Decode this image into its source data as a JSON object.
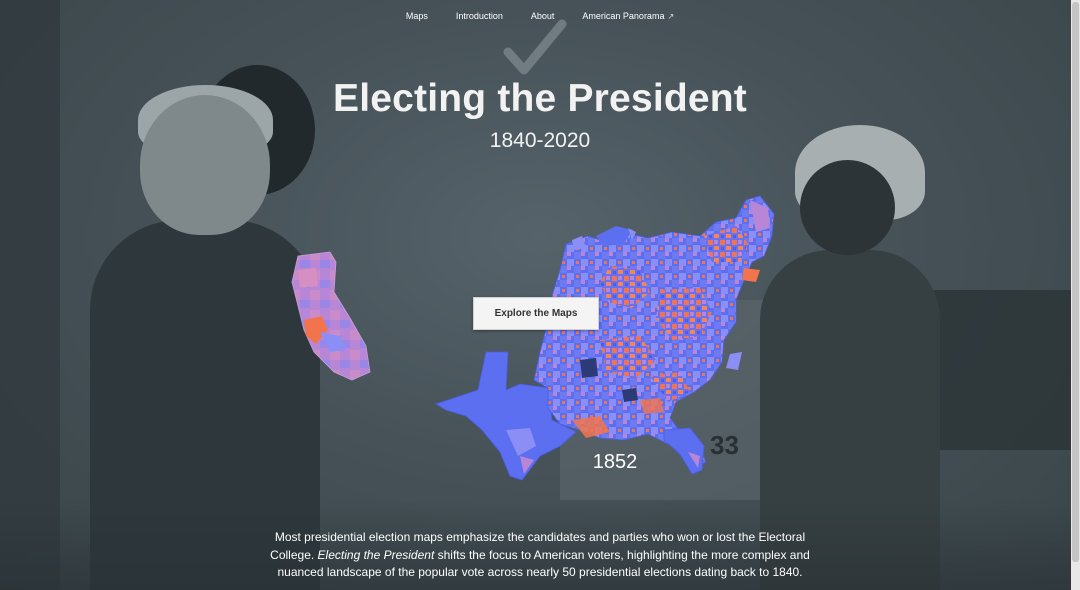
{
  "nav": {
    "items": [
      {
        "label": "Maps"
      },
      {
        "label": "Introduction"
      },
      {
        "label": "About"
      },
      {
        "label": "American Panorama"
      }
    ],
    "external_icon": "external-link-icon"
  },
  "hero": {
    "title": "Electing the President",
    "subtitle": "1840-2020"
  },
  "map": {
    "year": "1852",
    "colors": {
      "democrat": "#5b6ff0",
      "democrat_light": "#8a8ef5",
      "whig": "#f2744c",
      "mixed": "#b886d6",
      "background": "#46525a"
    }
  },
  "cta": {
    "label": "Explore the Maps"
  },
  "intro": {
    "part1": "Most presidential election maps emphasize the candidates and parties who won or lost the Electoral College. ",
    "italic": "Electing the President",
    "part2": " shifts the focus to American voters, highlighting the more complex and nuanced landscape of the popular vote across nearly 50 presidential elections dating back to 1840."
  },
  "background": {
    "booth_number": "33"
  }
}
